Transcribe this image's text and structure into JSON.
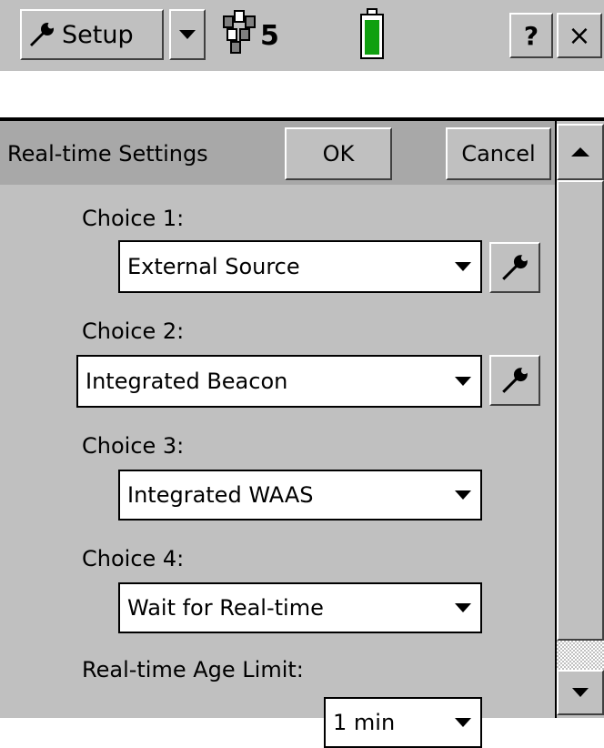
{
  "toolbar": {
    "setup_label": "Setup",
    "satellite_count": "5",
    "help_label": "?",
    "close_label": "×",
    "icons": [
      "wrench-icon",
      "satellite-icon",
      "battery-icon"
    ],
    "battery_color": "#10a010"
  },
  "form": {
    "title": "Real-time Settings",
    "ok_label": "OK",
    "cancel_label": "Cancel",
    "fields": [
      {
        "label": "Choice 1:",
        "value": "External Source",
        "has_config": true
      },
      {
        "label": "Choice 2:",
        "value": "Integrated Beacon",
        "has_config": true
      },
      {
        "label": "Choice 3:",
        "value": "Integrated WAAS",
        "has_config": false
      },
      {
        "label": "Choice 4:",
        "value": "Wait for Real-time",
        "has_config": false
      },
      {
        "label": "Real-time Age Limit:",
        "value": "1 min",
        "has_config": false
      }
    ]
  },
  "scrollbar": {
    "position_fraction": 0.0
  }
}
